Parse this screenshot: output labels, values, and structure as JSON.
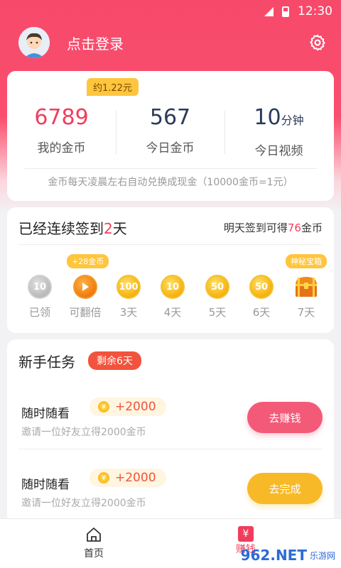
{
  "status": {
    "time": "12:30"
  },
  "header": {
    "login_text": "点击登录"
  },
  "stats": {
    "badge": "约1.22元",
    "coins": {
      "value": "6789",
      "label": "我的金币"
    },
    "today_coins": {
      "value": "567",
      "label": "今日金币"
    },
    "today_video": {
      "value": "10",
      "unit": "分钟",
      "label": "今日视频"
    },
    "note": "金币每天凌晨左右自动兑换成现金（10000金币=1元）"
  },
  "checkin": {
    "title_prefix": "已经连续签到",
    "title_days": "2",
    "title_suffix": "天",
    "tip_prefix": "明天签到可得",
    "tip_amount": "76",
    "tip_suffix": "金币",
    "bonus_tag": "+28金币",
    "chest_tag": "神秘宝箱",
    "days": [
      {
        "value": "10",
        "label": "已领"
      },
      {
        "value": "",
        "label": "可翻倍"
      },
      {
        "value": "100",
        "label": "3天"
      },
      {
        "value": "10",
        "label": "4天"
      },
      {
        "value": "50",
        "label": "5天"
      },
      {
        "value": "50",
        "label": "6天"
      },
      {
        "value": "",
        "label": "7天"
      }
    ]
  },
  "tasks": {
    "title": "新手任务",
    "remain": "剩余6天",
    "items": [
      {
        "title": "随时随看",
        "reward": "+2000",
        "desc": "邀请一位好友立得2000金币",
        "button": "去赚钱"
      },
      {
        "title": "随时随看",
        "reward": "+2000",
        "desc": "邀请一位好友立得2000金币",
        "button": "去完成"
      }
    ]
  },
  "tabbar": {
    "home": "首页",
    "earn": "赚钱"
  },
  "watermark": {
    "main": "962.NET",
    "sub": "乐游网"
  }
}
